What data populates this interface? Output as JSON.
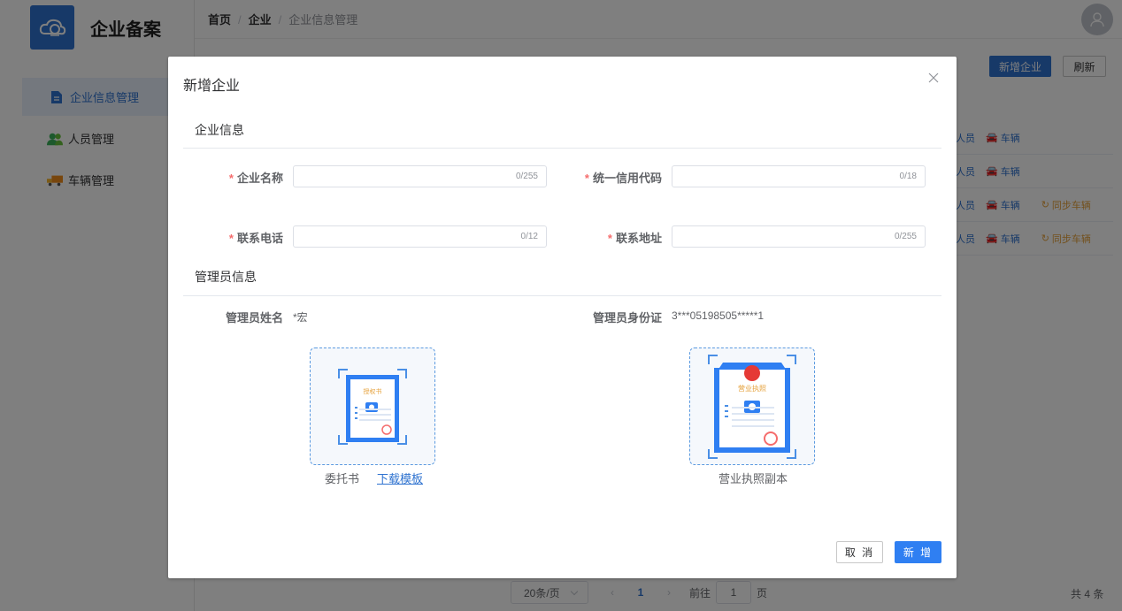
{
  "app": {
    "title": "企业备案"
  },
  "sidebar": {
    "items": [
      {
        "label": "企业信息管理",
        "icon": "document-icon",
        "active": true
      },
      {
        "label": "人员管理",
        "icon": "people-icon",
        "active": false
      },
      {
        "label": "车辆管理",
        "icon": "truck-icon",
        "active": false
      }
    ]
  },
  "breadcrumb": {
    "home": "首页",
    "sep": "/",
    "level2": "企业",
    "current": "企业信息管理"
  },
  "toolbar": {
    "add_label": "新增企业",
    "refresh_label": "刷新"
  },
  "table": {
    "rows": [
      {
        "people": "人员",
        "vehicles": "车辆",
        "sync": ""
      },
      {
        "people": "人员",
        "vehicles": "车辆",
        "sync": ""
      },
      {
        "people": "人员",
        "vehicles": "车辆",
        "sync": "同步车辆"
      },
      {
        "people": "人员",
        "vehicles": "车辆",
        "sync": "同步车辆"
      }
    ]
  },
  "pagination": {
    "page_size": "20条/页",
    "prev": "‹",
    "next": "›",
    "current": "1",
    "goto_label": "前往",
    "goto_value": "1",
    "page_suffix": "页",
    "total": "共 4 条"
  },
  "dialog": {
    "title": "新增企业",
    "close": "×",
    "section_company": "企业信息",
    "section_admin": "管理员信息",
    "fields": {
      "company_name": {
        "required": "*",
        "label": "企业名称",
        "value": "",
        "count": "0/255"
      },
      "credit_code": {
        "required": "*",
        "label": "统一信用代码",
        "value": "",
        "count": "0/18"
      },
      "phone": {
        "required": "*",
        "label": "联系电话",
        "value": "",
        "count": "0/12"
      },
      "address": {
        "required": "*",
        "label": "联系地址",
        "value": "",
        "count": "0/255"
      }
    },
    "admin": {
      "name_label": "管理员姓名",
      "name_value": "*宏",
      "id_label": "管理员身份证",
      "id_value": "3***05198505*****1"
    },
    "uploads": {
      "authorization": {
        "caption": "委托书",
        "link": "下载模板",
        "doc_title": "授权书"
      },
      "license": {
        "caption": "营业执照副本",
        "doc_title": "营业执照"
      }
    },
    "buttons": {
      "cancel": "取 消",
      "ok": "新 增"
    }
  },
  "colors": {
    "primary": "#2f73d0",
    "required": "#f56c6c",
    "sync": "#e6a23c"
  }
}
